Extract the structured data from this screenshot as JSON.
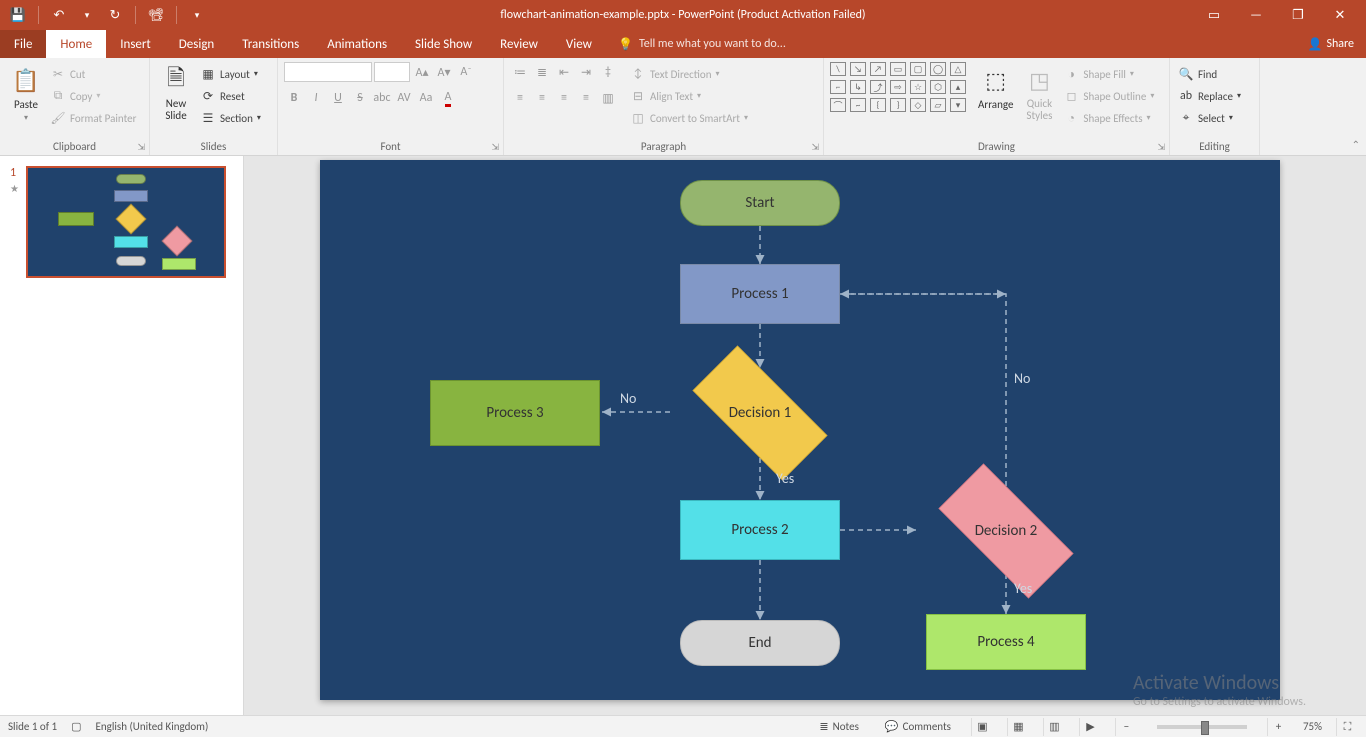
{
  "title": "flowchart-animation-example.pptx - PowerPoint (Product Activation Failed)",
  "qat": {
    "save": "💾",
    "undo": "↶",
    "redo": "↻",
    "start": "▶",
    "dropdown": "▾"
  },
  "tabs": {
    "file": "File",
    "home": "Home",
    "insert": "Insert",
    "design": "Design",
    "transitions": "Transitions",
    "animations": "Animations",
    "slideshow": "Slide Show",
    "review": "Review",
    "view": "View"
  },
  "tellme": "Tell me what you want to do...",
  "share": "Share",
  "ribbon": {
    "clipboard": {
      "paste": "Paste",
      "cut": "Cut",
      "copy": "Copy",
      "formatpainter": "Format Painter",
      "label": "Clipboard"
    },
    "slides": {
      "newslide": "New\nSlide",
      "layout": "Layout",
      "reset": "Reset",
      "section": "Section",
      "label": "Slides"
    },
    "font": {
      "label": "Font"
    },
    "paragraph": {
      "textdir": "Text Direction",
      "align": "Align Text",
      "smartart": "Convert to SmartArt",
      "label": "Paragraph"
    },
    "drawing": {
      "arrange": "Arrange",
      "quickstyles": "Quick\nStyles",
      "shapefill": "Shape Fill",
      "shapeoutline": "Shape Outline",
      "shapeeffects": "Shape Effects",
      "label": "Drawing"
    },
    "editing": {
      "find": "Find",
      "replace": "Replace",
      "select": "Select",
      "label": "Editing"
    }
  },
  "thumb": {
    "num": "1",
    "star": "★"
  },
  "flowchart": {
    "start": "Start",
    "p1": "Process 1",
    "p2": "Process 2",
    "p3": "Process 3",
    "p4": "Process 4",
    "d1": "Decision 1",
    "d2": "Decision 2",
    "end": "End",
    "yes": "Yes",
    "no": "No"
  },
  "watermark": {
    "line1": "Activate Windows",
    "line2": "Go to Settings to activate Windows."
  },
  "status": {
    "slide": "Slide 1 of 1",
    "lang": "English (United Kingdom)",
    "notes": "Notes",
    "comments": "Comments",
    "zoom": "75%"
  }
}
